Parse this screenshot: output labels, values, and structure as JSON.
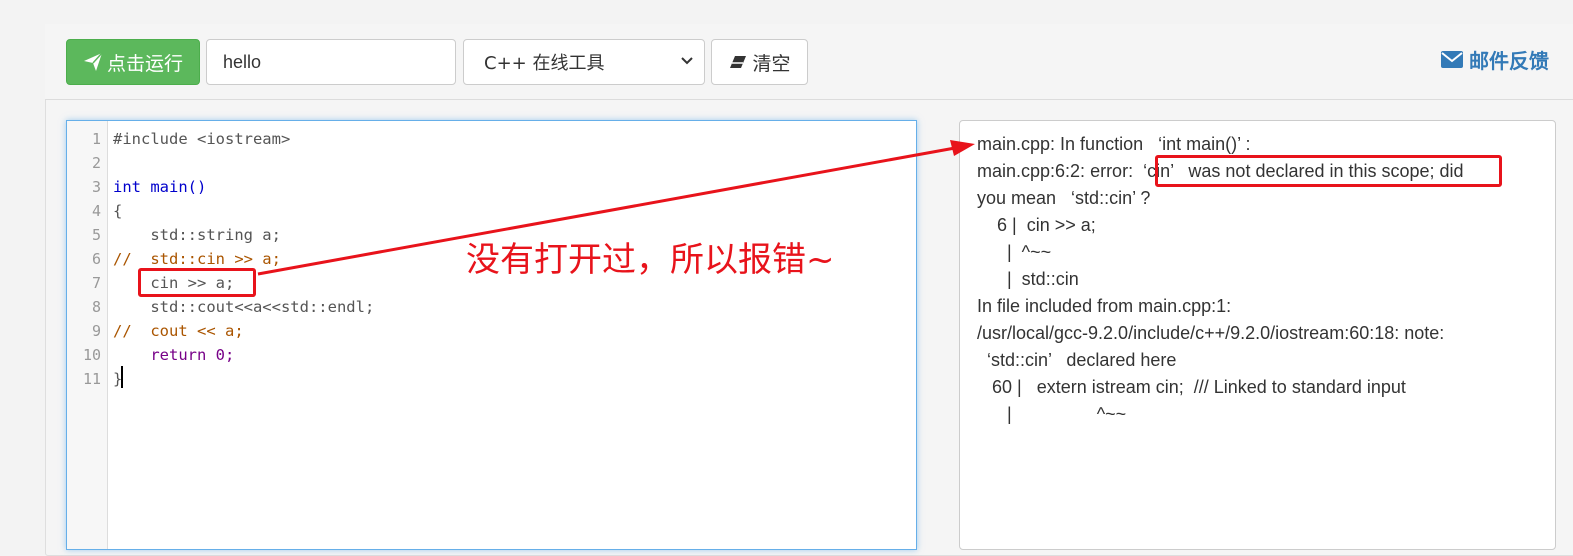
{
  "toolbar": {
    "run_label": "点击运行",
    "input_value": "hello",
    "language_selected": "C++ 在线工具",
    "clear_label": "清空",
    "feedback_label": "邮件反馈"
  },
  "icons": {
    "run": "paper-plane-icon",
    "clear": "eraser-icon",
    "feedback": "envelope-icon",
    "select": "chevron-down-icon"
  },
  "editor": {
    "lines": [
      {
        "n": "1",
        "text": "#include <iostream>"
      },
      {
        "n": "2",
        "text": ""
      },
      {
        "n": "3",
        "text": "int main()"
      },
      {
        "n": "4",
        "text": "{"
      },
      {
        "n": "5",
        "text": "    std::string a;"
      },
      {
        "n": "6",
        "text": "//  std::cin >> a;"
      },
      {
        "n": "7",
        "text": "    cin >> a;"
      },
      {
        "n": "8",
        "text": "    std::cout<<a<<std::endl;"
      },
      {
        "n": "9",
        "text": "//  cout << a;"
      },
      {
        "n": "10",
        "text": "    return 0;"
      },
      {
        "n": "11",
        "text": "}"
      }
    ]
  },
  "output": {
    "lines": [
      "main.cpp: In function   ‘int main()’ :",
      "main.cpp:6:2: error:  ‘cin’   was not declared in this scope; did",
      "you mean   ‘std::cin’ ?",
      "    6 |  cin >> a;",
      "      |  ^~~",
      "      |  std::cin",
      "In file included from main.cpp:1:",
      "/usr/local/gcc-9.2.0/include/c++/9.2.0/iostream:60:18: note:",
      "  ‘std::cin’   declared here",
      "   60 |   extern istream cin;  /// Linked to standard input",
      "      |                 ^~~"
    ]
  },
  "annotation": {
    "text": "没有打开过，所以报错~",
    "color": "#e8131b"
  },
  "colors": {
    "run_button": "#5cb85c",
    "link": "#337ab7",
    "highlight": "#e8131b"
  }
}
